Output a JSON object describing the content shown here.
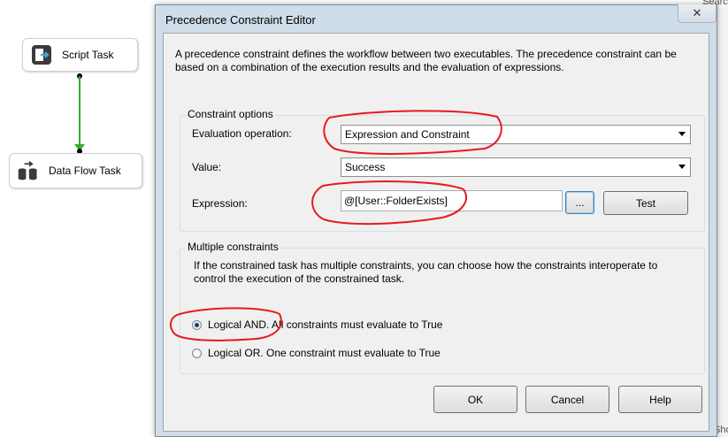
{
  "canvas": {
    "tasks": [
      {
        "label": "Script Task",
        "icon": "script-task-icon"
      },
      {
        "label": "Data Flow Task",
        "icon": "data-flow-task-icon"
      }
    ],
    "connector_color": "#3aaa35"
  },
  "background_right": {
    "top_text": "Search",
    "bottom_text": "Sho"
  },
  "dialog": {
    "title": "Precedence Constraint Editor",
    "close_glyph": "✕",
    "intro": "A precedence constraint defines the workflow between two executables. The precedence constraint can be based on a combination of the execution results and the evaluation of expressions.",
    "constraint_options": {
      "legend": "Constraint options",
      "evaluation_operation_label": "Evaluation operation:",
      "evaluation_operation_value": "Expression and Constraint",
      "value_label": "Value:",
      "value_value": "Success",
      "expression_label": "Expression:",
      "expression_value": "@[User::FolderExists]",
      "ellipsis_label": "...",
      "test_label": "Test"
    },
    "multiple_constraints": {
      "legend": "Multiple constraints",
      "description": "If the constrained task has multiple constraints, you can choose how the constraints interoperate to control the execution of the constrained task.",
      "options": [
        {
          "label": "Logical AND. All constraints must evaluate to True",
          "selected": true
        },
        {
          "label": "Logical OR. One constraint must evaluate to True",
          "selected": false
        }
      ]
    },
    "buttons": {
      "ok": "OK",
      "cancel": "Cancel",
      "help": "Help"
    }
  },
  "colors": {
    "annotation": "#e8191f",
    "dialog_frame": "#cfdce9",
    "client_bg": "#f0f0f0"
  }
}
